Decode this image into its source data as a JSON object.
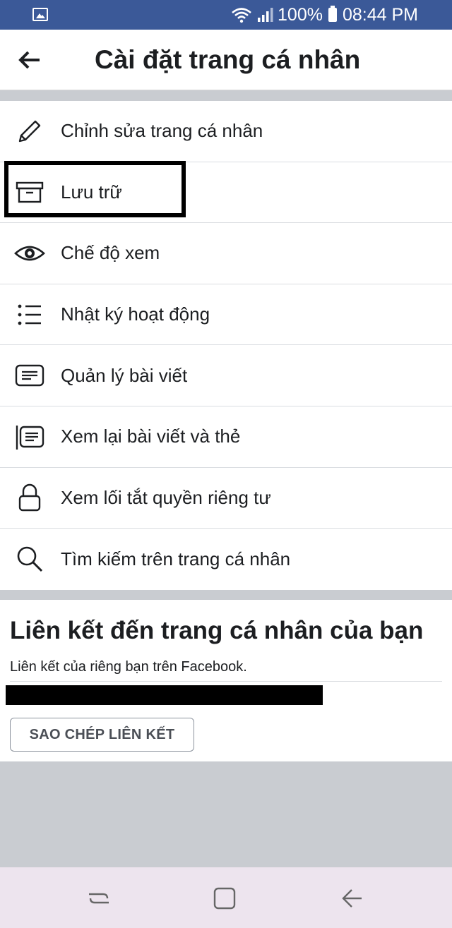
{
  "status_bar": {
    "battery_percent": "100%",
    "time": "08:44 PM",
    "icons": [
      "gallery-icon",
      "wifi-icon",
      "signal-icon",
      "battery-icon"
    ]
  },
  "header": {
    "title": "Cài đặt trang cá nhân",
    "back_icon": "back-arrow-icon"
  },
  "menu": {
    "items": [
      {
        "label": "Chỉnh sửa trang cá nhân",
        "icon": "pencil-icon"
      },
      {
        "label": "Lưu trữ",
        "icon": "archive-icon"
      },
      {
        "label": "Chế độ xem",
        "icon": "eye-icon"
      },
      {
        "label": "Nhật ký hoạt động",
        "icon": "list-icon"
      },
      {
        "label": "Quản lý bài viết",
        "icon": "posts-icon"
      },
      {
        "label": "Xem lại bài viết và thẻ",
        "icon": "review-icon"
      },
      {
        "label": "Xem lối tắt quyền riêng tư",
        "icon": "lock-icon"
      },
      {
        "label": "Tìm kiếm trên trang cá nhân",
        "icon": "search-icon"
      }
    ]
  },
  "link_section": {
    "title": "Liên kết đến trang cá nhân của bạn",
    "description": "Liên kết của riêng bạn trên Facebook.",
    "copy_button": "SAO CHÉP LIÊN KẾT"
  },
  "nav_bar": {
    "buttons": [
      "recents-icon",
      "home-icon",
      "back-icon"
    ]
  },
  "colors": {
    "status_bar": "#3b5998",
    "background": "#c9ccd1",
    "nav_bar": "#ede4ee"
  }
}
